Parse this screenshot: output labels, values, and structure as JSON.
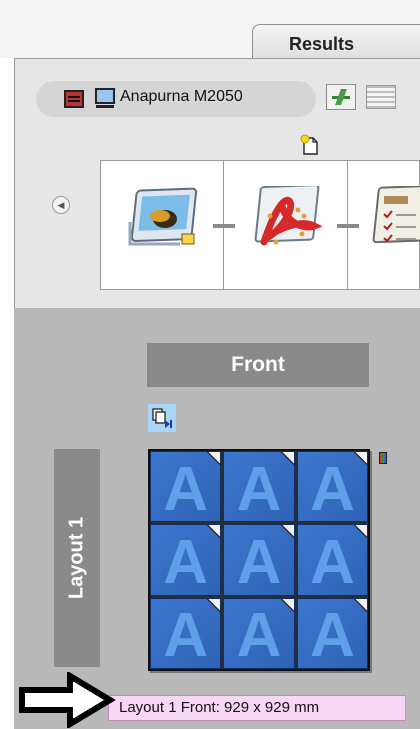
{
  "tabs": {
    "results_label": "Results"
  },
  "device": {
    "name": "Anapurna M2050",
    "icons": [
      "device-selector-icon",
      "monitor-icon",
      "edit-icon",
      "list-icon"
    ]
  },
  "workflow": {
    "steps": [
      {
        "name": "preflight-step",
        "icon": "image-edit-icon"
      },
      {
        "name": "pdf-step",
        "icon": "pdf-icon"
      },
      {
        "name": "checklist-step",
        "icon": "checklist-icon"
      }
    ]
  },
  "layout": {
    "side_label": "Front",
    "layout_name": "Layout 1",
    "grid": {
      "rows": 3,
      "cols": 3,
      "tile_glyph": "A"
    }
  },
  "tooltip": {
    "text": "Layout 1 Front: 929 x 929 mm"
  },
  "colors": {
    "label_bg": "#8a8a8a",
    "tile_blue": "#3c77cf",
    "tooltip_bg": "#f7d7f4"
  }
}
